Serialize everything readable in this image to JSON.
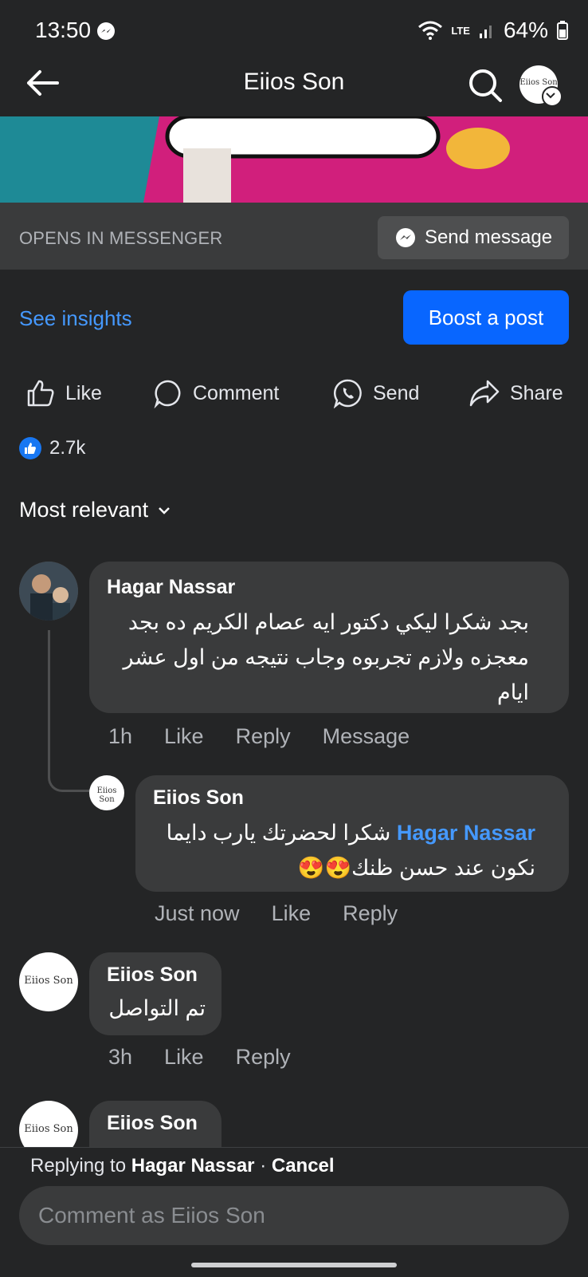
{
  "status_bar": {
    "time": "13:50",
    "network": "LTE",
    "battery": "64%"
  },
  "header": {
    "title": "Eiios Son"
  },
  "messenger_row": {
    "opens_label": "OPENS IN MESSENGER",
    "send_message_label": "Send message"
  },
  "promo": {
    "insights_label": "See insights",
    "boost_label": "Boost a post"
  },
  "actions": {
    "like": "Like",
    "comment": "Comment",
    "send": "Send",
    "share": "Share"
  },
  "reactions": {
    "count": "2.7k"
  },
  "sort": {
    "label": "Most relevant"
  },
  "comments": [
    {
      "author": "Hagar Nassar",
      "text": "بجد شكرا ليكي دكتور ايه عصام الكريم ده بجد معجزه ولازم تجربوه  وجاب نتيجه من اول عشر ايام",
      "time": "1h",
      "like": "Like",
      "reply": "Reply",
      "message": "Message",
      "replies": [
        {
          "author": "Eiios Son",
          "mention": "Hagar Nassar",
          "text": "شكرا لحضرتك يارب دايما نكون عند حسن ظنك😍😍",
          "time": "Just now",
          "like": "Like",
          "reply": "Reply"
        }
      ]
    },
    {
      "author": "Eiios Son",
      "text": "تم التواصل",
      "time": "3h",
      "like": "Like",
      "reply": "Reply"
    },
    {
      "author": "Eiios Son"
    }
  ],
  "page_logo": "Eiios Son",
  "footer": {
    "replying_prefix": "Replying to",
    "replying_name": "Hagar Nassar",
    "cancel": "Cancel",
    "input_placeholder": "Comment as Eiios Son"
  },
  "colors": {
    "background": "#242526",
    "bubble": "#3a3b3c",
    "accent": "#0866ff",
    "link": "#4599ff"
  }
}
